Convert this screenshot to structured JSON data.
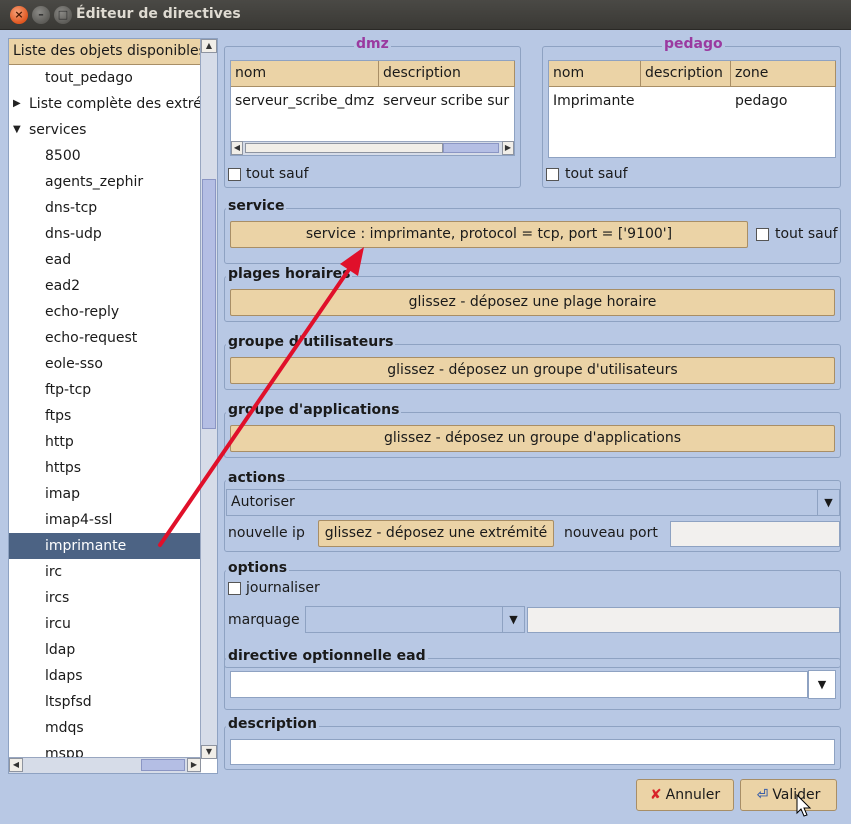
{
  "window": {
    "title": "Éditeur de directives",
    "close_glyph": "×",
    "min_glyph": "–",
    "max_glyph": "□"
  },
  "left_panel": {
    "header": "Liste des objets disponibles",
    "items": [
      {
        "label": "tout_pedago",
        "level": 1
      },
      {
        "label": "Liste complète des extrémités",
        "level": 0,
        "expander": "▶"
      },
      {
        "label": "services",
        "level": 0,
        "expander": "▼"
      },
      {
        "label": "8500",
        "level": 1
      },
      {
        "label": "agents_zephir",
        "level": 1
      },
      {
        "label": "dns-tcp",
        "level": 1
      },
      {
        "label": "dns-udp",
        "level": 1
      },
      {
        "label": "ead",
        "level": 1
      },
      {
        "label": "ead2",
        "level": 1
      },
      {
        "label": "echo-reply",
        "level": 1
      },
      {
        "label": "echo-request",
        "level": 1
      },
      {
        "label": "eole-sso",
        "level": 1
      },
      {
        "label": "ftp-tcp",
        "level": 1
      },
      {
        "label": "ftps",
        "level": 1
      },
      {
        "label": "http",
        "level": 1
      },
      {
        "label": "https",
        "level": 1
      },
      {
        "label": "imap",
        "level": 1
      },
      {
        "label": "imap4-ssl",
        "level": 1
      },
      {
        "label": "imprimante",
        "level": 1,
        "selected": true
      },
      {
        "label": "irc",
        "level": 1
      },
      {
        "label": "ircs",
        "level": 1
      },
      {
        "label": "ircu",
        "level": 1
      },
      {
        "label": "ldap",
        "level": 1
      },
      {
        "label": "ldaps",
        "level": 1
      },
      {
        "label": "ltspfsd",
        "level": 1
      },
      {
        "label": "mdqs",
        "level": 1
      },
      {
        "label": "mspp",
        "level": 1
      }
    ]
  },
  "dmz": {
    "title": "dmz",
    "columns": [
      "nom",
      "description"
    ],
    "row": [
      "serveur_scribe_dmz",
      "serveur scribe sur"
    ],
    "tout_sauf": "tout sauf"
  },
  "pedago": {
    "title": "pedago",
    "columns": [
      "nom",
      "description",
      "zone"
    ],
    "row": [
      "Imprimante",
      "",
      "pedago"
    ],
    "tout_sauf": "tout sauf"
  },
  "service": {
    "title": "service",
    "value": "service : imprimante, protocol = tcp, port = ['9100']",
    "tout_sauf": "tout sauf"
  },
  "plages": {
    "title": "plages horaires",
    "drop": "glissez - déposez une plage horaire"
  },
  "groupe_util": {
    "title": "groupe d'utilisateurs",
    "drop": "glissez - déposez un groupe d'utilisateurs"
  },
  "groupe_app": {
    "title": "groupe d'applications",
    "drop": "glissez - déposez un groupe d'applications"
  },
  "actions": {
    "title": "actions",
    "selected": "Autoriser",
    "nouvelle_ip": "nouvelle ip",
    "drop": "glissez - déposez une extrémité",
    "nouveau_port": "nouveau port"
  },
  "options": {
    "title": "options",
    "journaliser": "journaliser",
    "marquage": "marquage"
  },
  "ead": {
    "title": "directive optionnelle ead"
  },
  "description": {
    "title": "description"
  },
  "buttons": {
    "annuler": "Annuler",
    "valider": "Valider",
    "annuler_glyph": "✘",
    "valider_glyph": "⏎"
  },
  "icons": {
    "dropdown": "▼",
    "up": "▲",
    "down": "▼",
    "left": "◀",
    "right": "▶"
  },
  "colors": {
    "accent_zone": "#9a3aa0",
    "selected_row": "#4c6384",
    "drop_bg": "#ebd3a6",
    "arrow_annotation": "#e0102a"
  }
}
